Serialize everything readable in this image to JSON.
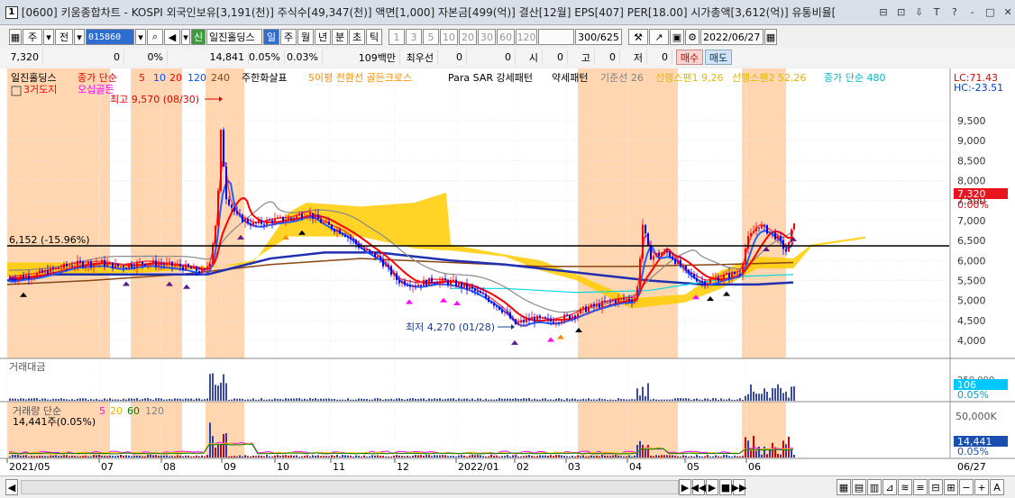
{
  "window": {
    "title": "[0600] 키움종합차트 - KOSPI 외국인보유[3,191(천)] 주식수[49,347(천)] 액면[1,000] 자본금[499(억)] 결산[12월] EPS[407] PER[18.00] 시가총액[3,612(억)] 유통비율[",
    "icon_label": "1",
    "buttons": [
      "⊟",
      "⊡",
      "⇩",
      "T",
      "?",
      "-",
      "□",
      "✕"
    ]
  },
  "toolbar": {
    "type_options": [
      "주",
      "전"
    ],
    "stock_code": "015860",
    "stock_name": "일진홀딩스",
    "period_buttons": [
      "일",
      "주",
      "월",
      "년",
      "분",
      "초",
      "틱"
    ],
    "active_period": "일",
    "interval_buttons": [
      "1",
      "3",
      "5",
      "10",
      "20",
      "30",
      "60",
      "120"
    ],
    "count": "300/625",
    "date": "2022/06/27",
    "prefix_badge": "신"
  },
  "quote": {
    "price": "7,320",
    "change": "0",
    "change_pct": "0%",
    "volume": "14,841",
    "vol_pct": "0.05%",
    "turnover_pct": "0.03%",
    "amount": "109백만",
    "preferred": "최우선",
    "pref_val1": "0",
    "pref_val2": "0",
    "open_label": "시",
    "open_val": "0",
    "high_label": "고",
    "high_val": "0",
    "low_label": "저",
    "low_val": "0",
    "buy_label": "매수",
    "sell_label": "매도"
  },
  "legend": {
    "stock": "일진홀딩스",
    "ma_label": "종가 단순",
    "ma_periods": [
      {
        "p": "5",
        "color": "#ff0000"
      },
      {
        "p": "10",
        "color": "#0050ff"
      },
      {
        "p": "20",
        "color": "#ff0000"
      },
      {
        "p": "120",
        "color": "#0050ff"
      },
      {
        "p": "240",
        "color": "#8b4513"
      }
    ],
    "items": [
      {
        "text": "주한화살표",
        "color": "#000000"
      },
      {
        "text": "5이평 전환선 골든크로스",
        "color": "#ff8c00"
      },
      {
        "text": "Para SAR 강세패턴",
        "color": "#000000"
      },
      {
        "text": "약세패턴",
        "color": "#000000"
      },
      {
        "text": "기준선 26",
        "color": "#808080"
      },
      {
        "text": "선행스팬1 9,26",
        "color": "#ffcc00"
      },
      {
        "text": "선행스팬2 52,26",
        "color": "#ffcc00"
      },
      {
        "text": "종가 단순 480",
        "color": "#00c8d0"
      }
    ],
    "row2": [
      {
        "text": "3거도지",
        "color": "#ff0000"
      },
      {
        "text": "오십골든",
        "color": "#ff00ff"
      }
    ],
    "lc": "LC:71.43",
    "hc": "HC:-23.51"
  },
  "annotations": {
    "high": "최고 9,570 (08/30)",
    "low": "최저 4,270 (01/28)",
    "hline": "6,152 (-15.96%)"
  },
  "price_axis": {
    "ticks": [
      "9,500",
      "9,000",
      "8,500",
      "8,000",
      "7,500",
      "7,000",
      "6,500",
      "6,000",
      "5,500",
      "5,000",
      "4,500",
      "4,000"
    ],
    "current": "7,320",
    "current_pct": "0.00%"
  },
  "panel2": {
    "title": "거래대금",
    "value": "106",
    "pct": "0.05%",
    "tick": "250,000"
  },
  "panel3": {
    "title": "거래량 단순",
    "periods": [
      {
        "p": "5",
        "color": "#ff00ff"
      },
      {
        "p": "20",
        "color": "#ffcc00"
      },
      {
        "p": "60",
        "color": "#008000"
      },
      {
        "p": "120",
        "color": "#808080"
      }
    ],
    "subtitle": "14,441주(0.05%)",
    "tick": "50,000K",
    "value": "14,441",
    "pct": "0.05%"
  },
  "date_axis": [
    "2021/05",
    "07",
    "08",
    "09",
    "10",
    "11",
    "12",
    "2022/01",
    "02",
    "03",
    "04",
    "05",
    "06"
  ],
  "date_end": "06/27",
  "colors": {
    "highlight": "#ffd6b0",
    "up": "#ff0000",
    "down": "#0000ff",
    "cloud": "#ffcc00"
  }
}
